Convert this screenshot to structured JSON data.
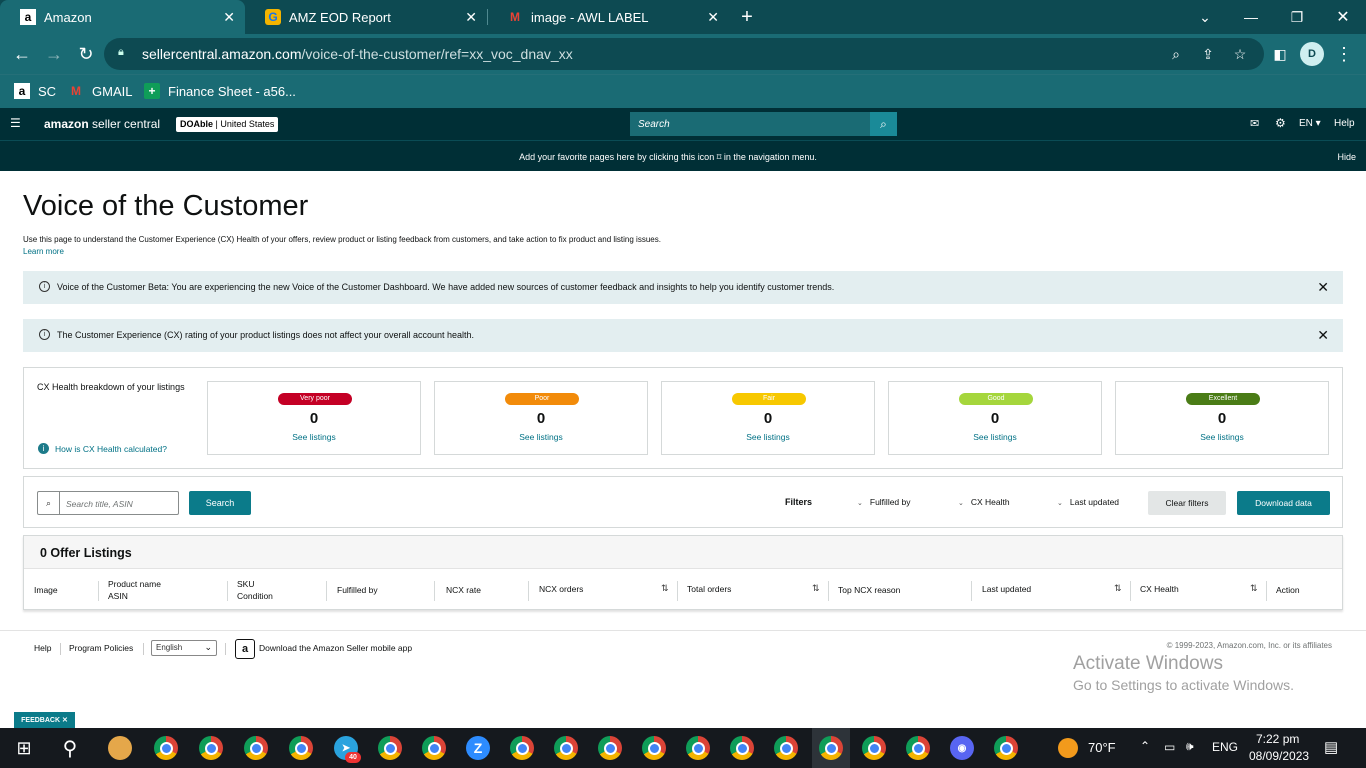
{
  "browser": {
    "tabs": [
      {
        "title": "Amazon",
        "favicon": "a"
      },
      {
        "title": "AMZ EOD Report",
        "favicon": "G"
      },
      {
        "title": "image - AWL LABEL",
        "favicon": "M"
      }
    ],
    "url_host": "sellercentral.amazon.com",
    "url_path": "/voice-of-the-customer/ref=xx_voc_dnav_xx",
    "profile_initial": "D",
    "bookmarks": [
      {
        "label": "SC",
        "icon": "a"
      },
      {
        "label": "GMAIL",
        "icon": "M"
      },
      {
        "label": "Finance Sheet - a56...",
        "icon": "+"
      }
    ]
  },
  "header": {
    "logo_brand": "amazon",
    "logo_suffix": "seller central",
    "store_name": "DOAble",
    "store_country": "United States",
    "search_placeholder": "Search",
    "language": "EN",
    "help": "Help"
  },
  "favorites_bar": {
    "message": "Add your favorite pages here by clicking this icon ⌑ in the navigation menu.",
    "hide": "Hide"
  },
  "page": {
    "title": "Voice of the Customer",
    "description": "Use this page to understand the Customer Experience (CX) Health of your offers, review product or listing feedback from customers, and take action to fix product and listing issues.",
    "learn_more": "Learn more"
  },
  "alerts": [
    {
      "text": "Voice of the Customer Beta: You are experiencing the new Voice of the Customer Dashboard. We have added new sources of customer feedback and insights to help you identify customer trends."
    },
    {
      "text": "The Customer Experience (CX) rating of your product listings does not affect your overall account health."
    }
  ],
  "cx_health": {
    "title": "CX Health breakdown of your listings",
    "how_link": "How is CX Health calculated?",
    "cards": [
      {
        "label": "Very poor",
        "count": "0",
        "link": "See listings",
        "color": "#c40025"
      },
      {
        "label": "Poor",
        "count": "0",
        "link": "See listings",
        "color": "#f28b0a"
      },
      {
        "label": "Fair",
        "count": "0",
        "link": "See listings",
        "color": "#f7c800"
      },
      {
        "label": "Good",
        "count": "0",
        "link": "See listings",
        "color": "#a5d63c"
      },
      {
        "label": "Excellent",
        "count": "0",
        "link": "See listings",
        "color": "#4a7c16"
      }
    ]
  },
  "filters": {
    "search_placeholder": "Search title, ASIN",
    "search_button": "Search",
    "label": "Filters",
    "dropdowns": [
      "Fulfilled by",
      "CX Health",
      "Last updated"
    ],
    "clear": "Clear filters",
    "download": "Download data"
  },
  "listings": {
    "title": "0 Offer Listings",
    "columns": [
      {
        "line1": "Image",
        "line2": ""
      },
      {
        "line1": "Product name",
        "line2": "ASIN"
      },
      {
        "line1": "SKU",
        "line2": "Condition"
      },
      {
        "line1": "Fulfilled by",
        "line2": ""
      },
      {
        "line1": "NCX rate",
        "line2": ""
      },
      {
        "line1": "NCX orders",
        "line2": ""
      },
      {
        "line1": "Total orders",
        "line2": ""
      },
      {
        "line1": "Top NCX reason",
        "line2": ""
      },
      {
        "line1": "Last updated",
        "line2": ""
      },
      {
        "line1": "CX Health",
        "line2": ""
      },
      {
        "line1": "Action",
        "line2": ""
      }
    ]
  },
  "footer": {
    "help": "Help",
    "policies": "Program Policies",
    "language": "English",
    "app_text": "Download the Amazon Seller mobile app",
    "copyright": "© 1999-2023, Amazon.com, Inc. or its affiliates",
    "activate_title": "Activate Windows",
    "activate_sub": "Go to Settings to activate Windows.",
    "feedback": "FEEDBACK"
  },
  "taskbar": {
    "weather": "70°F",
    "lang": "ENG",
    "time": "7:22 pm",
    "date": "08/09/2023",
    "telegram_badge": "40"
  }
}
